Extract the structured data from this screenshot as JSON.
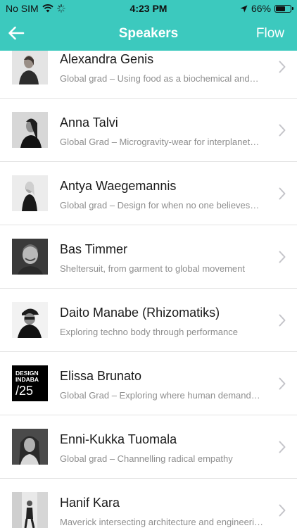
{
  "status_bar": {
    "carrier": "No SIM",
    "time": "4:23 PM",
    "battery": "66%",
    "battery_level": 0.66
  },
  "nav": {
    "title": "Speakers",
    "right_link": "Flow",
    "back_icon": "arrow-left-icon"
  },
  "colors": {
    "header_bg": "#3cc9be",
    "header_text": "#ffffff",
    "name_text": "#1a1a1a",
    "subtitle_text": "#8e8e8e",
    "divider": "#e3e3e3"
  },
  "speakers": [
    {
      "name": "Alexandra Genis",
      "talk": "Global grad – Using food as a biochemical and…",
      "photo": "portrait-woman-grey"
    },
    {
      "name": "Anna Talvi",
      "talk": "Global Grad – Microgravity-wear for interplanet…",
      "photo": "portrait-woman-profile"
    },
    {
      "name": "Antya Waegemannis",
      "talk": "Global grad – Design for when no one believes…",
      "photo": "portrait-woman-blonde"
    },
    {
      "name": "Bas Timmer",
      "talk": "Sheltersuit, from garment to global movement",
      "photo": "portrait-man-smiling"
    },
    {
      "name": "Daito Manabe (Rhizomatiks)",
      "talk": "Exploring techno body through performance",
      "photo": "portrait-man-cap"
    },
    {
      "name": "Elissa Brunato",
      "talk": "Global Grad – Exploring where human demand…",
      "photo": "design-indaba-logo",
      "logo_text": [
        "DESIGN",
        "INDABA",
        "/25"
      ]
    },
    {
      "name": "Enni-Kukka Tuomala",
      "talk": "Global grad –  Channelling radical empathy",
      "photo": "portrait-woman-dark"
    },
    {
      "name": "Hanif Kara",
      "talk": "Maverick intersecting architecture and engineeri…",
      "photo": "portrait-man-walking"
    }
  ]
}
